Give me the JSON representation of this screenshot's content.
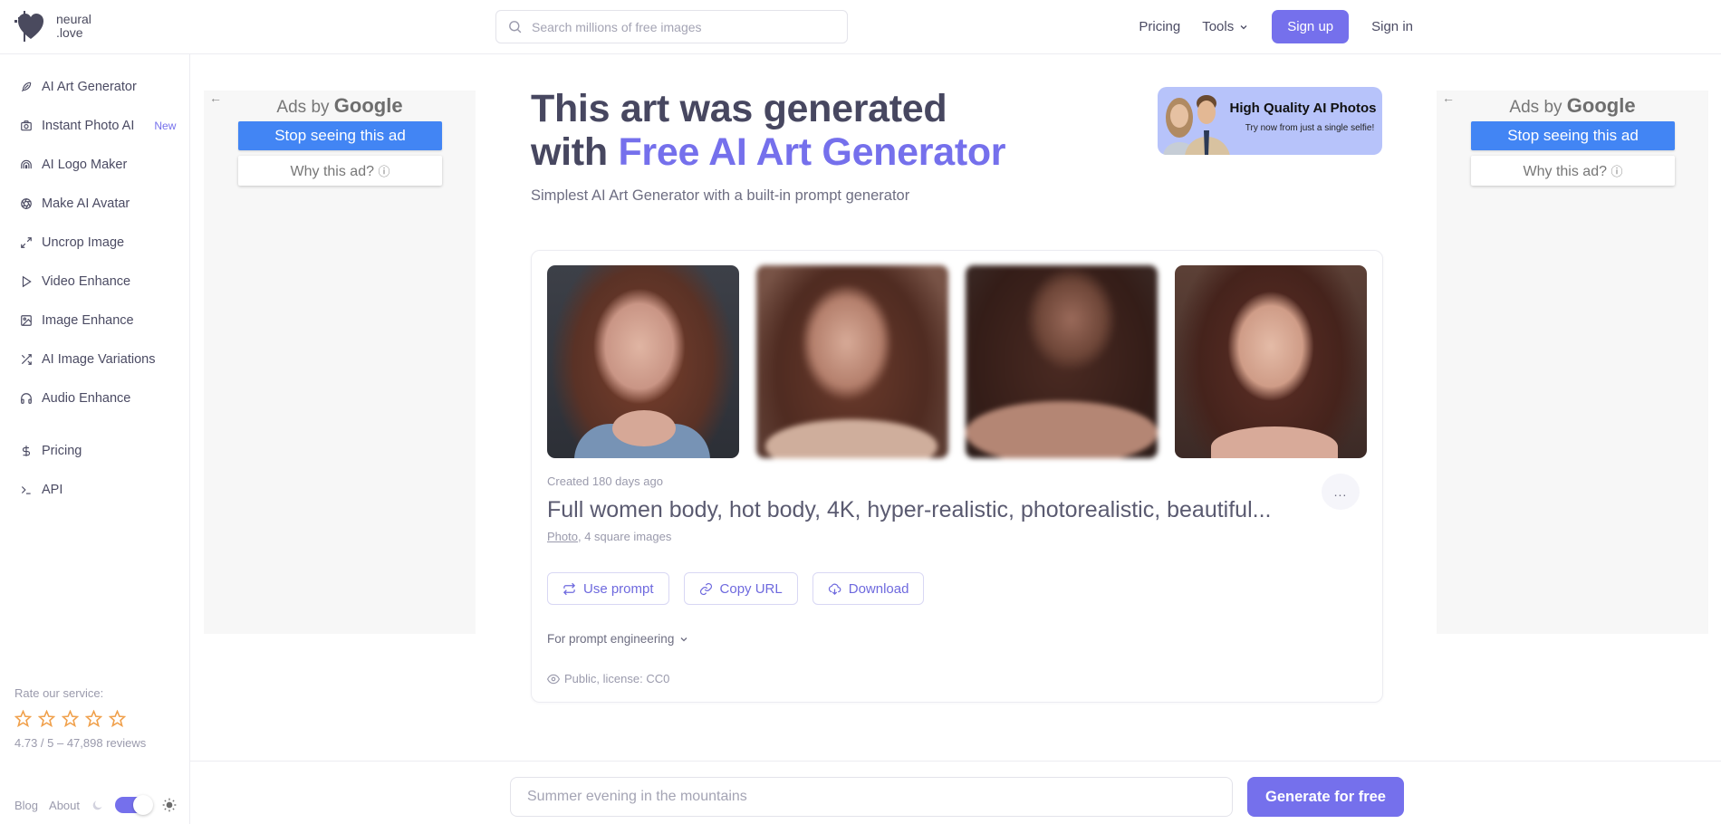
{
  "brand": {
    "name_line1": "neural",
    "name_line2": ".love",
    "accent_color": "#7570ec"
  },
  "search": {
    "placeholder": "Search millions of free images",
    "value": ""
  },
  "nav": {
    "pricing": "Pricing",
    "tools": "Tools",
    "signup": "Sign up",
    "signin": "Sign in"
  },
  "sidebar": {
    "items": [
      {
        "label": "AI Art Generator",
        "icon": "feather-icon"
      },
      {
        "label": "Instant Photo AI",
        "icon": "camera-icon",
        "badge": "New"
      },
      {
        "label": "AI Logo Maker",
        "icon": "rainbow-icon"
      },
      {
        "label": "Make AI Avatar",
        "icon": "aperture-icon"
      },
      {
        "label": "Uncrop Image",
        "icon": "expand-icon"
      },
      {
        "label": "Video Enhance",
        "icon": "play-icon"
      },
      {
        "label": "Image Enhance",
        "icon": "image-icon"
      },
      {
        "label": "AI Image Variations",
        "icon": "shuffle-icon"
      },
      {
        "label": "Audio Enhance",
        "icon": "headphones-icon"
      },
      {
        "label": "Pricing",
        "icon": "dollar-icon"
      },
      {
        "label": "API",
        "icon": "terminal-icon"
      }
    ],
    "rate_label": "Rate our service:",
    "stars_total": 5,
    "rating_text": "4.73 / 5 – 47,898 reviews",
    "footer": {
      "blog": "Blog",
      "about": "About",
      "theme": "light"
    }
  },
  "ads": {
    "back_icon": "arrow-left-icon",
    "ads_by": "Ads by",
    "google": "Google",
    "stop": "Stop seeing this ad",
    "why": "Why this ad?",
    "why_icon": "info-icon"
  },
  "hero": {
    "title_line1": "This art was generated",
    "title_with": "with",
    "title_accent": "Free AI Art Generator",
    "subtitle": "Simplest AI Art Generator with a built-in prompt generator"
  },
  "promo": {
    "title": "High Quality AI Photos",
    "subtitle": "Try now from just a single selfie!"
  },
  "card": {
    "images": [
      {
        "alt": "Generated portrait 1",
        "blurred": false
      },
      {
        "alt": "Generated portrait 2",
        "blurred": true
      },
      {
        "alt": "Generated portrait 3",
        "blurred": true
      },
      {
        "alt": "Generated portrait 4",
        "blurred": false
      }
    ],
    "created": "Created 180 days ago",
    "prompt": "Full women body, hot body, 4K, hyper-realistic, photorealistic, beautiful...",
    "style_link": "Photo",
    "meta_rest": ", 4 square images",
    "more_label": "...",
    "actions": {
      "use_prompt": "Use prompt",
      "copy_url": "Copy URL",
      "download": "Download"
    },
    "prompt_engineering": "For prompt engineering",
    "license": "Public, license: CC0"
  },
  "generator": {
    "placeholder": "Summer evening in the mountains",
    "value": "",
    "button": "Generate for free"
  }
}
